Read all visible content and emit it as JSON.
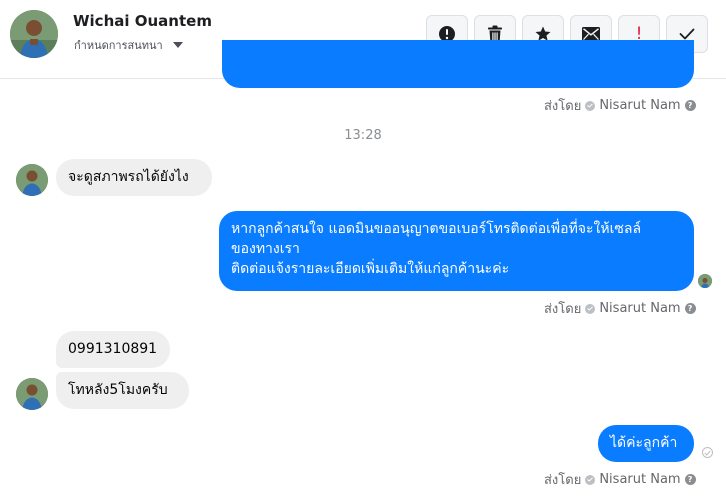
{
  "header": {
    "contact_name": "Wichai Ouantem",
    "settings_label": "กำหนดการสนทนา"
  },
  "actions": [
    {
      "icon": "alert-circle-icon",
      "label": "alert"
    },
    {
      "icon": "trash-icon",
      "label": "delete"
    },
    {
      "icon": "star-icon",
      "label": "star"
    },
    {
      "icon": "envelope-icon",
      "label": "mark unread"
    },
    {
      "icon": "exclamation-icon",
      "label": "!"
    },
    {
      "icon": "checkmark-icon",
      "label": "done"
    }
  ],
  "messages": {
    "sent_by_prefix": "ส่งโดย",
    "sender_name": "Nisarut Nam",
    "help_glyph": "?",
    "timestamp": "13:28",
    "in_1": "จะดูสภาพรถได้ยังไง",
    "out_1_line1": "หากลูกค้าสนใจ แอดมินขออนุญาตขอเบอร์โทรติดต่อเพื่อที่จะให้เซลล์",
    "out_1_line2": "ของทางเรา",
    "out_1_line3": "ติดต่อแจ้งรายละเอียดเพิ่มเติมให้แก่ลูกค้านะค่ะ",
    "in_2": "0991310891",
    "in_3": "โทหลัง5โมงครับ",
    "out_2": "ได้ค่ะลูกค้า"
  },
  "colors": {
    "outgoing_bubble": "#0a7cff",
    "incoming_bubble": "#efeff0",
    "alert_red": "#e41e3f"
  }
}
